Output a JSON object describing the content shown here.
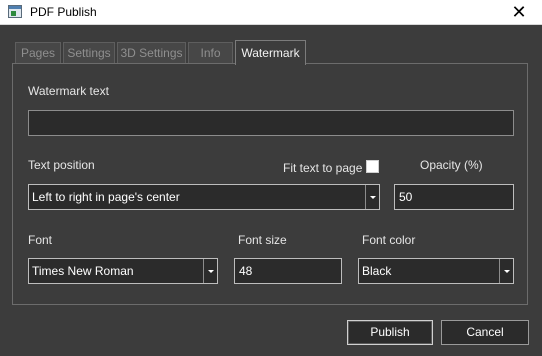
{
  "window": {
    "title": "PDF Publish",
    "close_glyph": "✕",
    "icon": "pdf-publish-app-icon"
  },
  "tabs": [
    {
      "label": "Pages",
      "active": false
    },
    {
      "label": "Settings",
      "active": false
    },
    {
      "label": "3D Settings",
      "active": false
    },
    {
      "label": "Info",
      "active": false
    },
    {
      "label": "Watermark",
      "active": true
    }
  ],
  "watermark": {
    "text_label": "Watermark text",
    "text_value": "",
    "position_label": "Text position",
    "position_value": "Left to right in page's center",
    "fit_label": "Fit text to page",
    "fit_checked": false,
    "opacity_label": "Opacity (%)",
    "opacity_value": "50",
    "font_label": "Font",
    "font_value": "Times New Roman",
    "font_size_label": "Font size",
    "font_size_value": "48",
    "font_color_label": "Font color",
    "font_color_value": "Black"
  },
  "buttons": {
    "publish": "Publish",
    "cancel": "Cancel"
  },
  "colors": {
    "background": "#3c3c3c",
    "field_background": "#2b2b2b",
    "titlebar": "#ffffff"
  }
}
